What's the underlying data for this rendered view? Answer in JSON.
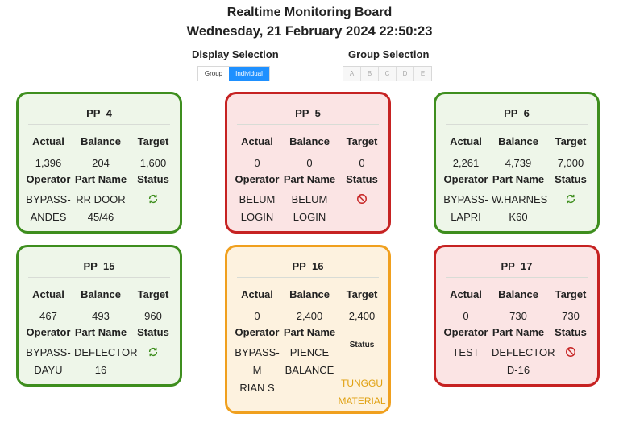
{
  "header": {
    "title": "Realtime Monitoring Board",
    "datetime": "Wednesday, 21 February 2024 22:50:23"
  },
  "display_selection": {
    "label": "Display Selection",
    "options": [
      "Group",
      "Individual"
    ],
    "selected": "Individual"
  },
  "group_selection": {
    "label": "Group Selection",
    "options": [
      "A",
      "B",
      "C",
      "D",
      "E"
    ]
  },
  "labels": {
    "actual": "Actual",
    "balance": "Balance",
    "target": "Target",
    "operator": "Operator",
    "part_name": "Part Name",
    "status": "Status"
  },
  "cards": [
    {
      "name": "PP_4",
      "actual": "1,396",
      "balance": "204",
      "target": "1,600",
      "operator_l1": "BYPASS-",
      "operator_l2": "ANDES",
      "part_l1": "RR DOOR",
      "part_l2": "45/46",
      "status": "running",
      "color": "#3e8e1e"
    },
    {
      "name": "PP_5",
      "actual": "0",
      "balance": "0",
      "target": "0",
      "operator_l1": "BELUM",
      "operator_l2": "LOGIN",
      "part_l1": "BELUM",
      "part_l2": "LOGIN",
      "status": "stopped",
      "color": "#c62222"
    },
    {
      "name": "PP_6",
      "actual": "2,261",
      "balance": "4,739",
      "target": "7,000",
      "operator_l1": "BYPASS-",
      "operator_l2": "LAPRI",
      "part_l1": "W.HARNES",
      "part_l2": "K60",
      "status": "running",
      "color": "#3e8e1e"
    },
    {
      "name": "PP_15",
      "actual": "467",
      "balance": "493",
      "target": "960",
      "operator_l1": "BYPASS-",
      "operator_l2": "DAYU",
      "part_l1": "DEFLECTOR",
      "part_l2": "16",
      "status": "running",
      "color": "#3e8e1e"
    },
    {
      "name": "PP_16",
      "actual": "0",
      "balance": "2,400",
      "target": "2,400",
      "operator_l1": "BYPASS-M",
      "operator_l2": "RIAN S",
      "part_l1": "PIENCE",
      "part_l2": "BALANCE",
      "status": "waiting",
      "status_l1": "TUNGGU",
      "status_l2": "MATERIAL",
      "color": "#f0a01e"
    },
    {
      "name": "PP_17",
      "actual": "0",
      "balance": "730",
      "target": "730",
      "operator_l1": "TEST",
      "operator_l2": "",
      "part_l1": "DEFLECTOR",
      "part_l2": "D-16",
      "status": "stopped",
      "color": "#c62222"
    }
  ]
}
